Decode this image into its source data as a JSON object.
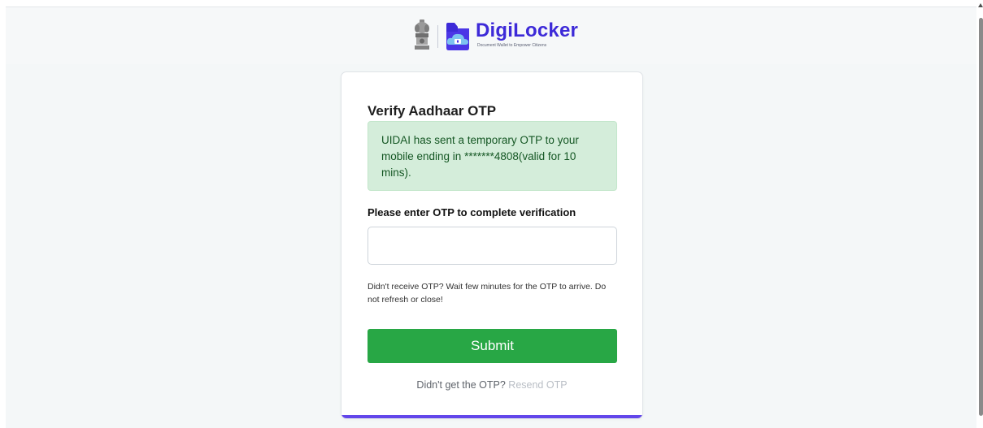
{
  "header": {
    "logo_title": "DigiLocker",
    "logo_tagline": "Document Wallet to Empower Citizens"
  },
  "card": {
    "title": "Verify Aadhaar OTP",
    "alert_text": "UIDAI has sent a temporary OTP to your mobile ending in *******4808(valid for 10 mins).",
    "field_label": "Please enter OTP to complete verification",
    "otp_value": "",
    "help_text": "Didn't receive OTP? Wait few minutes for the OTP to arrive. Do not refresh or close!",
    "submit_label": "Submit",
    "resend_prompt": "Didn't get the OTP?",
    "resend_link": "Resend OTP"
  },
  "colors": {
    "brand": "#3d2ad8",
    "accent": "#6246ea",
    "success": "#28a745",
    "alert_bg": "#d4edda",
    "alert_text": "#155724"
  }
}
